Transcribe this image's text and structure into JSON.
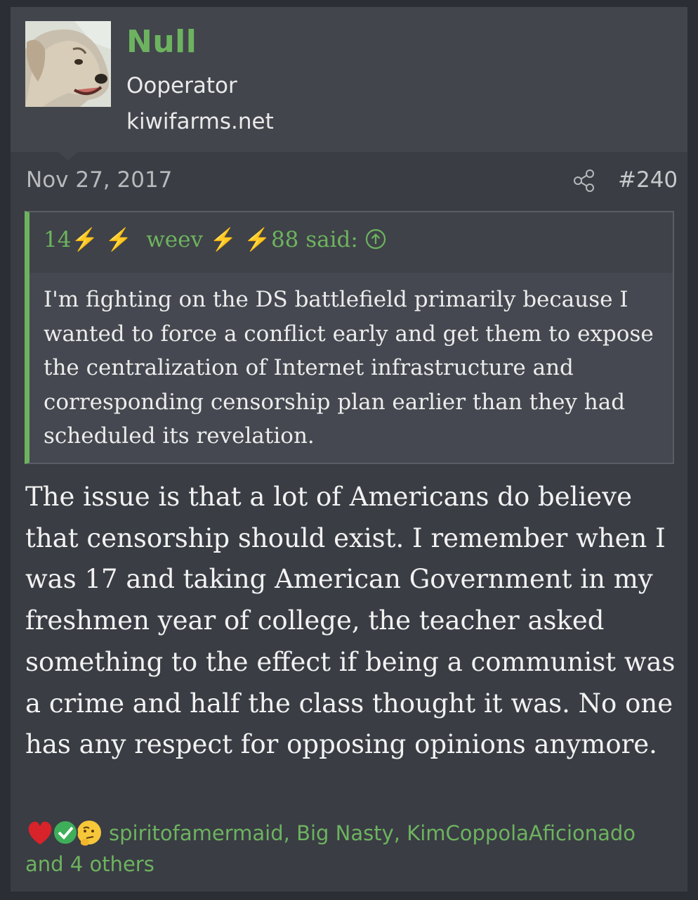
{
  "user": {
    "name": "Null",
    "title": "Ooperator",
    "banner": "kiwifarms.net"
  },
  "post": {
    "date": "Nov 27, 2017",
    "number": "#240"
  },
  "quote": {
    "author_prefix": "14",
    "author_name": "weev",
    "author_suffix": "88",
    "said_label": "said:",
    "bolt": "⚡",
    "text": "I'm fighting on the DS battlefield primarily because I wanted to force a conflict early and get them to expose the centralization of Internet infrastructure and corresponding censorship plan earlier than they had scheduled its revelation."
  },
  "message": {
    "text": "The issue is that a lot of Americans do believe that censorship should exist. I remember when I was 17 and taking American Government in my freshmen year of college, the teacher asked something to the effect if being a communist was a crime and half the class thought it was. No one has any respect for opposing opinions anymore."
  },
  "reactions": {
    "icons": [
      "heart-icon",
      "checkmark-icon",
      "thinking-face-icon"
    ],
    "users": "spiritofamermaid, Big Nasty, KimCoppolaAficionado",
    "others": "and 4 others"
  },
  "colors": {
    "accent_green": "#6db35f",
    "bolt_yellow": "#f3c21a",
    "heart_red": "#d8232a",
    "check_green": "#3fae5a"
  }
}
